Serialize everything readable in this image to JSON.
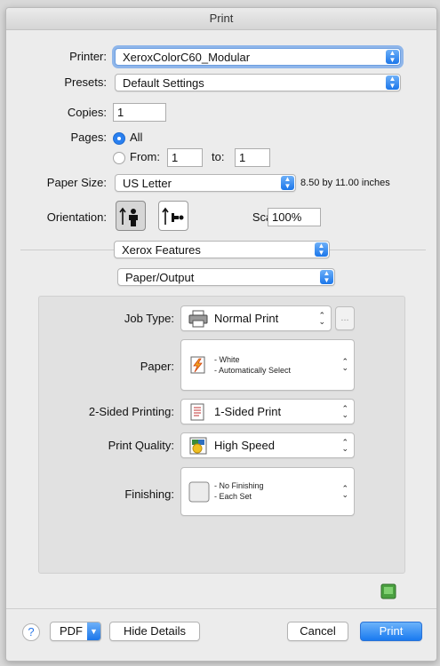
{
  "window": {
    "title": "Print"
  },
  "printer": {
    "label": "Printer:",
    "value": "XeroxColorC60_Modular"
  },
  "presets": {
    "label": "Presets:",
    "value": "Default Settings"
  },
  "copies": {
    "label": "Copies:",
    "value": "1"
  },
  "pages": {
    "label": "Pages:",
    "all_label": "All",
    "from_label": "From:",
    "from_value": "1",
    "to_label": "to:",
    "to_value": "1",
    "selected": "All"
  },
  "paper_size": {
    "label": "Paper Size:",
    "value": "US Letter",
    "dimensions": "8.50 by 11.00 inches"
  },
  "orientation": {
    "label": "Orientation:",
    "selected": "portrait",
    "options": [
      "portrait-icon",
      "landscape-icon"
    ]
  },
  "scale": {
    "label": "Scale:",
    "value": "100%"
  },
  "section_popup": {
    "value": "Xerox Features"
  },
  "sub_popup": {
    "value": "Paper/Output"
  },
  "features": {
    "job_type": {
      "label": "Job Type:",
      "value": "Normal Print",
      "more_label": "..."
    },
    "paper": {
      "label": "Paper:",
      "line1": "- White",
      "line2": "- Automatically Select"
    },
    "two_sided": {
      "label": "2-Sided Printing:",
      "value": "1-Sided Print"
    },
    "quality": {
      "label": "Print Quality:",
      "value": "High Speed"
    },
    "finishing": {
      "label": "Finishing:",
      "line1": "- No Finishing",
      "line2": "- Each Set"
    }
  },
  "footer": {
    "help_label": "?",
    "pdf_label": "PDF",
    "hide_details_label": "Hide Details",
    "cancel_label": "Cancel",
    "print_label": "Print"
  },
  "colors": {
    "accent": "#1a7af0",
    "background": "#ececec",
    "panel": "#e1e1e1"
  }
}
